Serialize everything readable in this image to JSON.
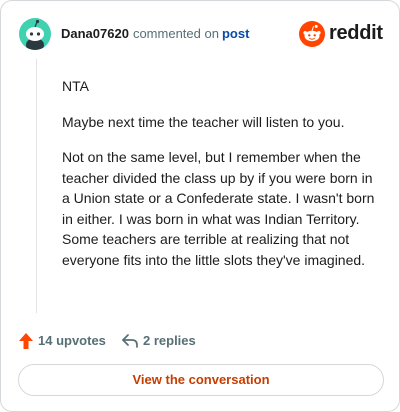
{
  "header": {
    "username": "Dana07620",
    "commented_text": "commented on",
    "post_link": "post",
    "logo_text": "reddit",
    "logo_icon": "reddit-snoo-icon",
    "avatar_icon": "snoo-avatar-icon"
  },
  "comment": {
    "paragraphs": [
      "NTA",
      "Maybe next time the teacher will listen to you.",
      "Not on the same level, but I remember when the teacher divided the class up by if you were born in a Union state or a Confederate state. I wasn't born in either. I was born in what was Indian Territory. Some teachers are terrible at realizing that not everyone fits into the little slots they've imagined."
    ]
  },
  "actions": {
    "upvotes_label": "14 upvotes",
    "upvote_icon": "upvote-arrow-icon",
    "replies_label": "2 replies",
    "reply_icon": "reply-arrow-icon"
  },
  "footer": {
    "view_button_label": "View the conversation"
  },
  "colors": {
    "brand": "#ff4500",
    "avatar_bg": "#3fd1b0",
    "link": "#0a4aa8",
    "button_text": "#c63d00",
    "muted": "#576f76"
  }
}
